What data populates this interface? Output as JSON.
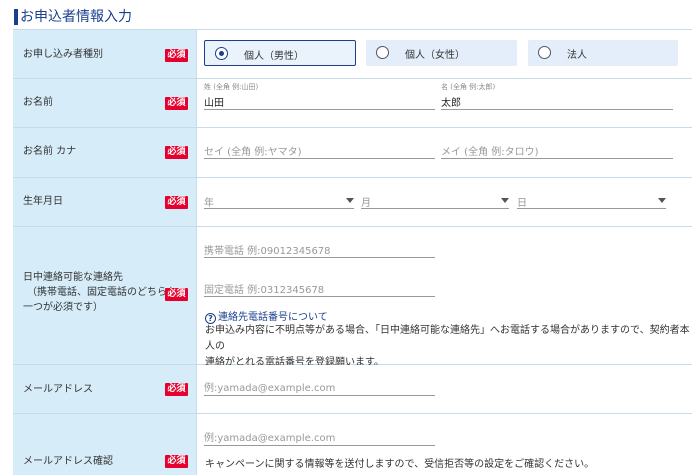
{
  "section": {
    "title": "お申込者情報入力"
  },
  "required_label": "必須",
  "rows": {
    "type": {
      "label": "お申し込み者種別",
      "options": [
        {
          "label": "個人（男性）",
          "selected": true
        },
        {
          "label": "個人（女性）",
          "selected": false
        },
        {
          "label": "法人",
          "selected": false
        }
      ]
    },
    "name": {
      "label": "お名前",
      "last": {
        "small_label": "姓 (全角 例:山田)",
        "value": "山田"
      },
      "first": {
        "small_label": "名 (全角 例:太郎)",
        "value": "太郎"
      }
    },
    "kana": {
      "label": "お名前 カナ",
      "last_placeholder": "セイ (全角 例:ヤマタ)",
      "first_placeholder": "メイ (全角 例:タロウ)"
    },
    "birth": {
      "label": "生年月日",
      "year": "年",
      "month": "月",
      "day": "日"
    },
    "contact": {
      "label_line1": "日中連絡可能な連絡先",
      "label_line2": "（携帯電話、固定電話のどちらか",
      "label_line3": "一つが必須です）",
      "mobile_placeholder": "携帯電話 例:09012345678",
      "landline_placeholder": "固定電話 例:0312345678",
      "help_icon": "?",
      "help_link": "連絡先電話番号について",
      "note_line1": "お申込み内容に不明点等がある場合、「日中連絡可能な連絡先」へお電話する場合がありますので、契約者本人の",
      "note_line2": "連絡がとれる電話番号を登録願います。"
    },
    "email": {
      "label": "メールアドレス",
      "placeholder": "例:yamada@example.com"
    },
    "email_confirm": {
      "label": "メールアドレス確認",
      "placeholder": "例:yamada@example.com",
      "note": "キャンペーンに関する情報等を送付しますので、受信拒否等の設定をご確認ください。"
    }
  },
  "colors": {
    "accent": "#1a3f8f",
    "required_bg": "#e6002d",
    "label_bg": "#d6ecf9"
  }
}
